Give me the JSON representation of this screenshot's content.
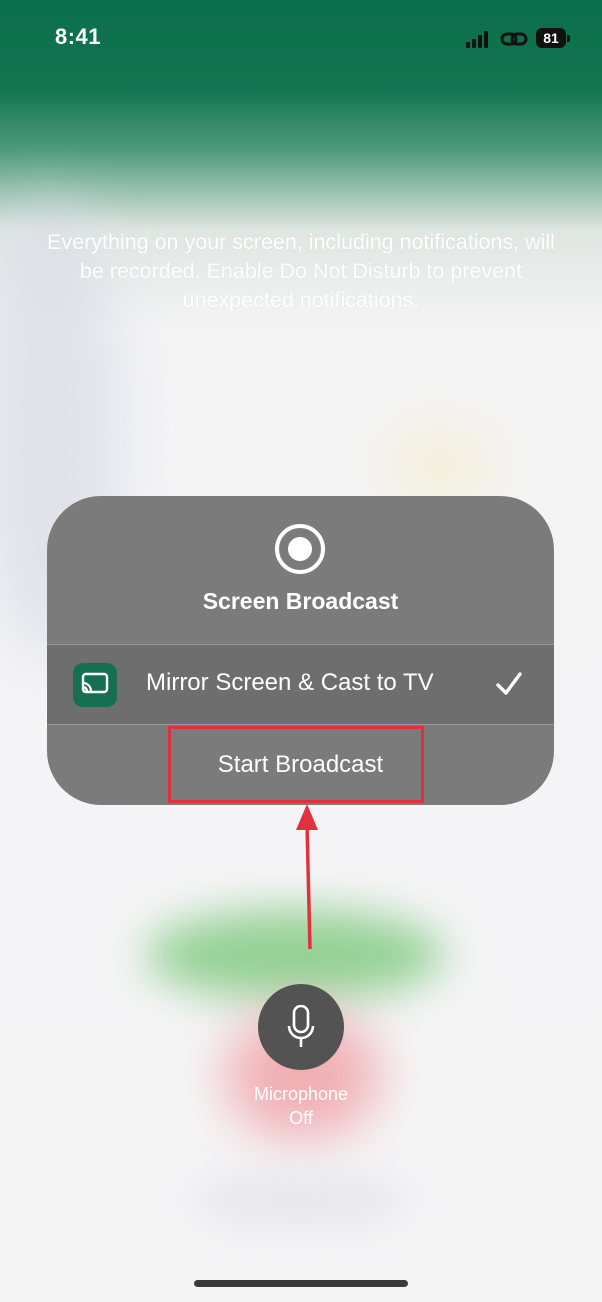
{
  "status_bar": {
    "time": "8:41",
    "battery_level": "81",
    "signal_icon": "cellular-signal-icon",
    "link_icon": "personal-hotspot-link-icon"
  },
  "notice": {
    "text": "Everything on your screen, including notifications, will be recorded. Enable Do Not Disturb to prevent unexpected notifications."
  },
  "broadcast_sheet": {
    "icon": "screen-record-icon",
    "title": "Screen Broadcast",
    "extension": {
      "label": "Mirror Screen & Cast to TV",
      "icon": "cast-to-tv-app-icon",
      "selected": true,
      "app_icon_color": "#16704f"
    },
    "start_button_label": "Start Broadcast"
  },
  "microphone": {
    "icon": "microphone-icon",
    "label_line1": "Microphone",
    "label_line2": "Off"
  },
  "annotation": {
    "highlight_color": "#e1313e",
    "target": "Start Broadcast"
  },
  "colors": {
    "header_green": "#0b6e4c",
    "sheet_gray": "#7b7b7b",
    "row_gray": "#6e6e6e"
  }
}
